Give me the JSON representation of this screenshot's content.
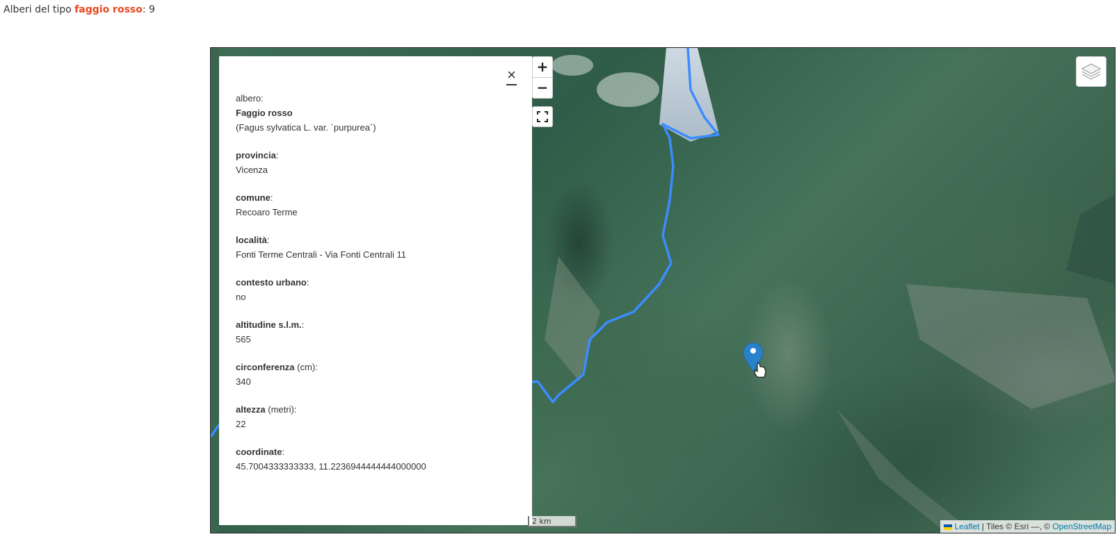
{
  "header": {
    "prefix": "Alberi del tipo ",
    "species": "faggio rosso",
    "suffix": ": 9"
  },
  "popup": {
    "close_symbol": "×",
    "tree_label": "albero:",
    "tree_name": "Faggio rosso",
    "tree_latin": "(Fagus sylvatica L. var. `purpurea`)",
    "fields": [
      {
        "key": "provincia",
        "unit": ":",
        "value": "Vicenza"
      },
      {
        "key": "comune",
        "unit": ":",
        "value": "Recoaro Terme"
      },
      {
        "key": "località",
        "unit": ":",
        "value": "Fonti Terme Centrali - Via Fonti Centrali 11"
      },
      {
        "key": "contesto urbano",
        "unit": ":",
        "value": "no"
      },
      {
        "key": "altitudine s.l.m.",
        "unit": ":",
        "value": "565"
      },
      {
        "key": "circonferenza",
        "unit": " (cm):",
        "value": "340"
      },
      {
        "key": "altezza",
        "unit": " (metri):",
        "value": "22"
      },
      {
        "key": "coordinate",
        "unit": ":",
        "value": "45.7004333333333, 11.2236944444444000000"
      }
    ]
  },
  "map": {
    "zoom_in": "+",
    "zoom_out": "−",
    "scale_label": "2 km",
    "attribution": {
      "leaflet": "Leaflet",
      "tiles": " | Tiles © Esri —, © ",
      "osm": "OpenStreetMap"
    },
    "colors": {
      "border_line": "#3b8cff",
      "marker": "#2a81cb",
      "highlight": "#e8461e"
    },
    "icons": [
      "fullscreen-icon",
      "layers-icon",
      "marker-icon",
      "hand-cursor-icon"
    ]
  }
}
